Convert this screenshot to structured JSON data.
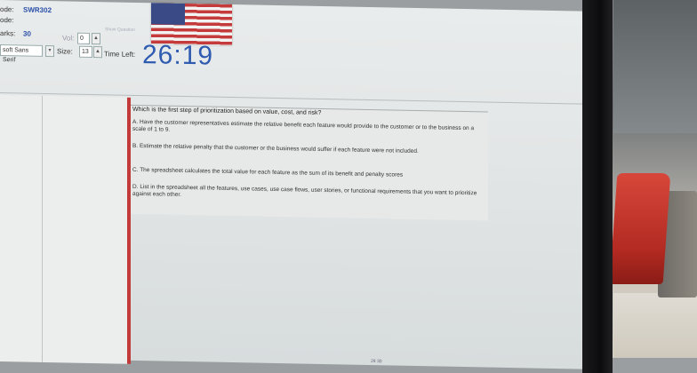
{
  "header": {
    "code_label": "ode:",
    "code_value": "SWR302",
    "code2_label": "ode:",
    "marks_label": "arks:",
    "marks_value": "30",
    "vol_label": "Vol:",
    "vol_value": "0",
    "font_value": "soft Sans Serif",
    "size_label": "Size:",
    "size_value": "13",
    "time_left_label": "Time Left:",
    "timer_value": "26:19",
    "show_question_label": "Show Question"
  },
  "question": {
    "text": "Which is the first step of prioritization based on value, cost, and risk?",
    "options": [
      {
        "letter": "A.",
        "text": "Have the customer representatives estimate the relative benefit each feature would provide to the customer or to the business on a scale of 1 to 9."
      },
      {
        "letter": "B.",
        "text": "Estimate the relative penalty that the customer or the business would suffer if each feature were not included."
      },
      {
        "letter": "C.",
        "text": "The spreadsheet calculates the total value for each feature as the sum of its benefit and penalty scores"
      },
      {
        "letter": "D.",
        "text": "List in the spreadsheet all the features, use cases, use case flows, user stories, or functional requirements that you want to prioritize against each other."
      }
    ]
  },
  "footer": {
    "page_text": "29   30"
  }
}
